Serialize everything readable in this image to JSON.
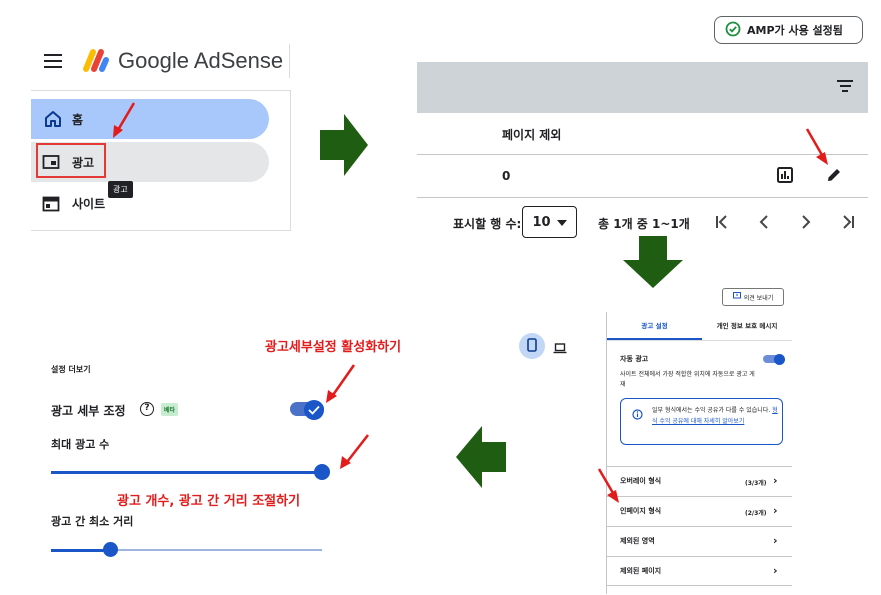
{
  "sidebar": {
    "brand": "Google AdSense",
    "items": [
      {
        "label": "홈",
        "icon": "home-icon"
      },
      {
        "label": "광고",
        "icon": "ads-icon"
      },
      {
        "label": "사이트",
        "icon": "sites-icon"
      }
    ],
    "tooltip": "광고"
  },
  "pages_panel": {
    "amp_status": "AMP가 사용 설정됨",
    "column_label": "페이지 제외",
    "row_value": "0",
    "rows_per_page_label": "표시할 행 수:",
    "rows_per_page_value": "10",
    "count_label": "총 1개 중 1~1개"
  },
  "settings_panel": {
    "feedback": "의견 보내기",
    "tab_ad_settings": "광고 설정",
    "tab_privacy": "개인 정보 보호 메시지",
    "auto_ads": "자동 광고",
    "auto_ads_desc": "사이트 전체에서 가장 적합한 위치에 자동으로 광고 게재",
    "info_text": "일부 형식에서는 수익 공유가 다를 수 있습니다.",
    "info_link": "형식 수익 공유에 대해 자세히 알아보기",
    "list": [
      {
        "label": "오버레이 형식",
        "count": "(3/3개)"
      },
      {
        "label": "인페이지 형식",
        "count": "(2/3개)"
      },
      {
        "label": "제외된 영역",
        "count": ""
      },
      {
        "label": "제외된 페이지",
        "count": ""
      }
    ]
  },
  "ad_settings": {
    "more_settings": "설정 더보기",
    "fine_tune": "광고 세부 조정",
    "beta": "베타",
    "max_ads": "최대 광고 수",
    "min_distance": "광고 간 최소 거리",
    "max_ads_level": 1.0,
    "min_distance_level": 0.22
  },
  "annotations": {
    "enable": "광고세부설정 활성화하기",
    "adjust": "광고 개수, 광고 간 거리 조절하기"
  },
  "colors": {
    "accent": "#1a56c8",
    "arrow": "#1e5d12",
    "annotation": "#e31b1b",
    "nav_active": "#a8c7fa"
  }
}
